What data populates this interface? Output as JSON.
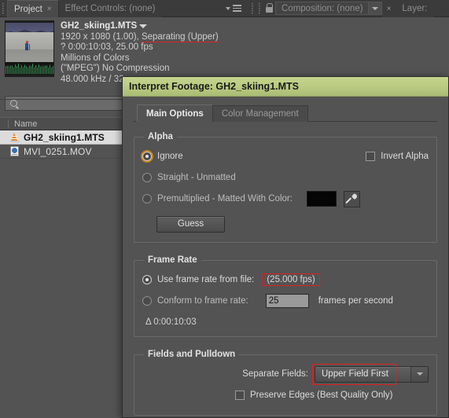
{
  "panels": {
    "project_tab": "Project",
    "project_tab_close": "×",
    "effect_controls_tab": "Effect Controls: (none)",
    "composition_tab": "Composition: (none)",
    "composition_tab_close": "×",
    "layer_tab": "Layer:"
  },
  "footage_info": {
    "title": "GH2_skiing1.MTS",
    "line_dimensions_prefix": "1920 x 1080 (1.00), ",
    "line_dimensions_highlight": "Separating (Upper)",
    "line_duration": "? 0:00:10:03, 25.00 fps",
    "line_colors": "Millions of Colors",
    "line_codec": "(\"MPEG\") No Compression",
    "line_audio": "48.000 kHz / 32"
  },
  "search": {
    "placeholder": "",
    "value": "",
    "icon": "search-icon"
  },
  "file_list": {
    "column_header": "Name",
    "rows": [
      {
        "name": "GH2_skiing1.MTS",
        "icon": "vlc-cone-icon",
        "selected": true
      },
      {
        "name": "MVI_0251.MOV",
        "icon": "quicktime-mov-icon",
        "selected": false
      }
    ]
  },
  "dialog": {
    "title": "Interpret Footage: GH2_skiing1.MTS",
    "tabs": [
      {
        "label": "Main Options",
        "active": true
      },
      {
        "label": "Color Management",
        "active": false
      }
    ],
    "alpha": {
      "legend": "Alpha",
      "ignore_label": "Ignore",
      "invert_alpha_label": "Invert Alpha",
      "invert_alpha_checked": false,
      "straight_label": "Straight - Unmatted",
      "premultiplied_label": "Premultiplied - Matted With Color:",
      "matte_color": "#050505",
      "eyedropper_icon": "eyedropper-icon",
      "guess_label": "Guess",
      "selected": "Ignore"
    },
    "frame_rate": {
      "legend": "Frame Rate",
      "use_from_file_label": "Use frame rate from file:",
      "use_from_file_value": "(25.000 fps)",
      "conform_label": "Conform to frame rate:",
      "conform_value": "25",
      "fps_suffix": "frames per second",
      "duration_delta": "Δ 0:00:10:03",
      "selected": "Use frame rate from file"
    },
    "fields": {
      "legend": "Fields and Pulldown",
      "separate_fields_label": "Separate Fields:",
      "separate_fields_value": "Upper Field First",
      "preserve_edges_label": "Preserve Edges (Best Quality Only)",
      "preserve_edges_checked": false
    }
  },
  "colors": {
    "highlight_red": "#e02020",
    "title_green": "#bccc83",
    "focus_orange": "#c8821e",
    "panel_bg": "#535353"
  }
}
